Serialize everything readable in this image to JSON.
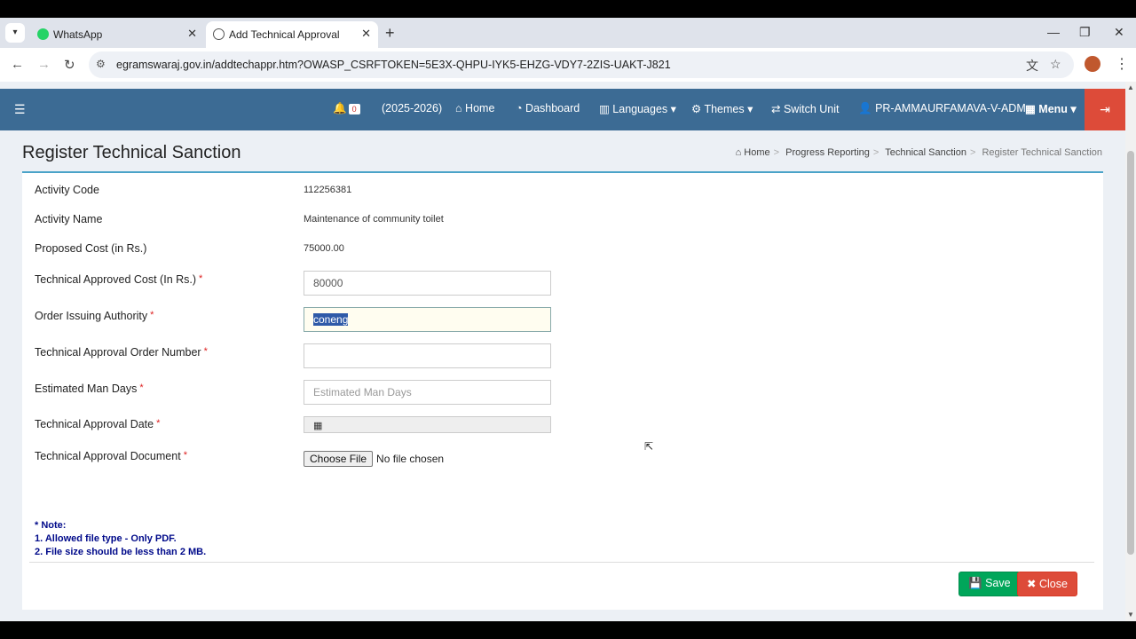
{
  "browser": {
    "tabs": [
      {
        "label": "WhatsApp",
        "icon": "whatsapp-icon"
      },
      {
        "label": "Add Technical Approval",
        "icon": "globe-icon"
      }
    ],
    "url": "egramswaraj.gov.in/addtechappr.htm?OWASP_CSRFTOKEN=5E3X-QHPU-IYK5-EHZG-VDY7-2ZIS-UAKT-J821"
  },
  "navbar": {
    "notification_count": "0",
    "year": "(2025-2026)",
    "home": "Home",
    "dashboard": "Dashboard",
    "languages": "Languages",
    "themes": "Themes",
    "switch_unit": "Switch Unit",
    "user": "PR-AMMAURFAMAVA-V-ADM",
    "menu": "Menu"
  },
  "page": {
    "title": "Register Technical Sanction",
    "breadcrumb": [
      "Home",
      "Progress Reporting",
      "Technical Sanction",
      "Register Technical Sanction"
    ]
  },
  "form": {
    "activity_code_label": "Activity Code",
    "activity_code": "112256381",
    "activity_name_label": "Activity Name",
    "activity_name": "Maintenance of community toilet",
    "proposed_cost_label": "Proposed Cost (in Rs.)",
    "proposed_cost": "75000.00",
    "tech_cost_label": "Technical Approved Cost (In Rs.)",
    "tech_cost_value": "80000",
    "authority_label": "Order Issuing Authority",
    "authority_value": "coneng",
    "order_number_label": "Technical Approval Order Number",
    "order_number_value": "",
    "man_days_label": "Estimated Man Days",
    "man_days_placeholder": "Estimated Man Days",
    "date_label": "Technical Approval Date",
    "document_label": "Technical Approval Document",
    "choose_file": "Choose File",
    "no_file": "No file chosen",
    "required_mark": "*"
  },
  "note": {
    "title": "* Note:",
    "line1": "1. Allowed file type - Only PDF.",
    "line2": "2. File size should be less than 2 MB."
  },
  "buttons": {
    "save": "Save",
    "close": "Close"
  },
  "colors": {
    "navbar": "#3c6b94",
    "save": "#00a65a",
    "close": "#dd4b39",
    "note": "#000a8a"
  }
}
